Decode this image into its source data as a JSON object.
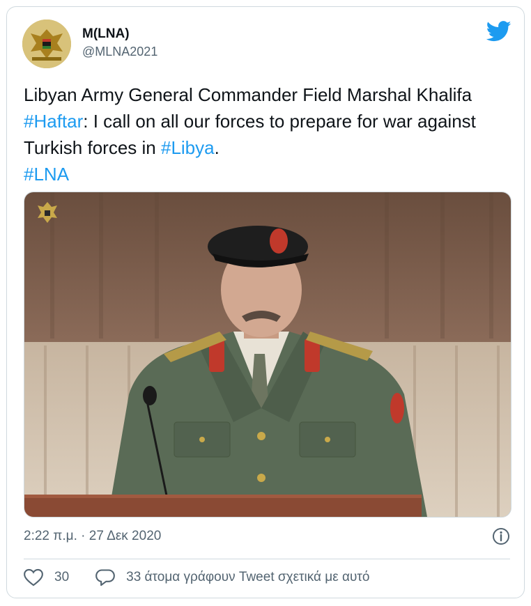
{
  "tweet": {
    "author_name": "M(LNA)",
    "author_handle": "@MLNA2021",
    "text_parts": {
      "p1": "Libyan Army General Commander Field Marshal Khalifa ",
      "hashtag1": "#Haftar",
      "p2": ": I call on all our forces to prepare for war against Turkish forces in ",
      "hashtag2": "#Libya",
      "p3": ".",
      "hashtag3": "#LNA"
    },
    "timestamp": "2:22 π.μ. · 27 Δεκ 2020",
    "likes_count": "30",
    "reply_text": "33 άτομα γράφουν Tweet σχετικά με αυτό"
  },
  "colors": {
    "link": "#1d9bf0",
    "muted": "#536471",
    "border": "#cfd9de"
  },
  "icons": [
    "twitter-bird-icon",
    "info-icon",
    "heart-icon",
    "reply-bubble-icon",
    "emblem-icon"
  ]
}
